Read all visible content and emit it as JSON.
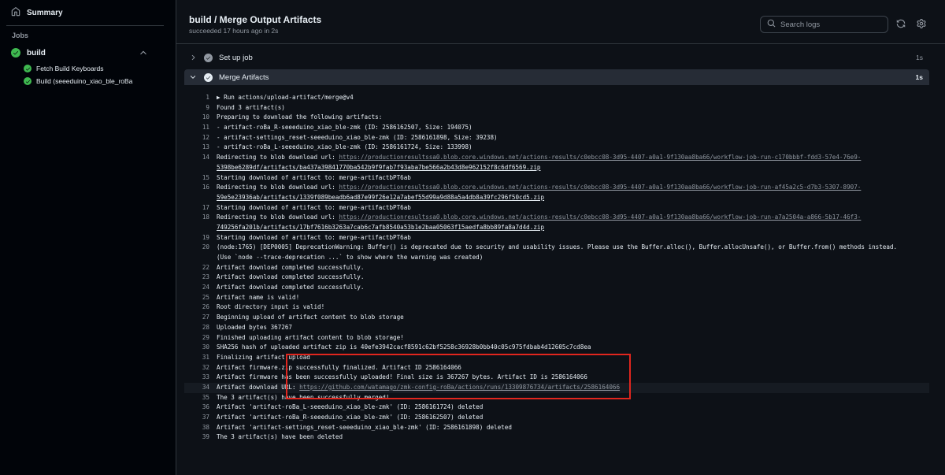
{
  "sidebar": {
    "summary_label": "Summary",
    "jobs_heading": "Jobs",
    "job": {
      "label": "build"
    },
    "steps": [
      {
        "label": "Fetch Build Keyboards"
      },
      {
        "label": "Build (seeeduino_xiao_ble_roBa"
      }
    ]
  },
  "header": {
    "title": "build / Merge Output Artifacts",
    "subtitle": "succeeded 17 hours ago in 2s",
    "search_placeholder": "Search logs"
  },
  "steps": [
    {
      "label": "Set up job",
      "duration": "1s"
    },
    {
      "label": "Merge Artifacts",
      "duration": "1s"
    }
  ],
  "log": [
    {
      "n": "1",
      "t": "▶ Run actions/upload-artifact/merge@v4"
    },
    {
      "n": "9",
      "t": "Found 3 artifact(s)"
    },
    {
      "n": "10",
      "t": "Preparing to download the following artifacts:"
    },
    {
      "n": "11",
      "t": "- artifact-roBa_R-seeeduino_xiao_ble-zmk (ID: 2586162507, Size: 194075)"
    },
    {
      "n": "12",
      "t": "- artifact-settings_reset-seeeduino_xiao_ble-zmk (ID: 2586161898, Size: 39238)"
    },
    {
      "n": "13",
      "t": "- artifact-roBa_L-seeeduino_xiao_ble-zmk (ID: 2586161724, Size: 133998)"
    },
    {
      "n": "14",
      "t": "Redirecting to blob download url: ",
      "link": "https://productionresultssa0.blob.core.windows.net/actions-results/c0ebcc08-3d95-4407-a0a1-9f130aa8ba66/workflow-job-run-c170bbbf-fdd3-57e4-76e9-",
      "cont": "5398be6289df/artifacts/ba437a39841770ba542b9f9fab7f93aba7be566a2b43d8e962152f8c6df6569.zip"
    },
    {
      "n": "15",
      "t": "Starting download of artifact to: merge-artifactbPT6ab"
    },
    {
      "n": "16",
      "t": "Redirecting to blob download url: ",
      "link": "https://productionresultssa0.blob.core.windows.net/actions-results/c0ebcc08-3d95-4407-a0a1-9f130aa8ba66/workflow-job-run-af45a2c5-d7b3-5307-8907-",
      "cont": "59e5e23936ab/artifacts/1339f089beadb6ad87e99f26e12a7abef55d99a9d88a5a4db8a39fc296f50cd5.zip"
    },
    {
      "n": "17",
      "t": "Starting download of artifact to: merge-artifactbPT6ab"
    },
    {
      "n": "18",
      "t": "Redirecting to blob download url: ",
      "link": "https://productionresultssa0.blob.core.windows.net/actions-results/c0ebcc08-3d95-4407-a0a1-9f130aa8ba66/workflow-job-run-a7a2504a-a866-5b17-46f3-",
      "cont": "749256fa201b/artifacts/17bf7616b3263a7cab6c7afb8540a53b1e2baa05063f15aedfa8bb89fa8a7d4d.zip"
    },
    {
      "n": "19",
      "t": "Starting download of artifact to: merge-artifactbPT6ab"
    },
    {
      "n": "20",
      "t": "(node:1765) [DEP0005] DeprecationWarning: Buffer() is deprecated due to security and usability issues. Please use the Buffer.alloc(), Buffer.allocUnsafe(), or Buffer.from() methods instead.",
      "cont_plain": "(Use `node --trace-deprecation ...` to show where the warning was created)"
    },
    {
      "n": "22",
      "t": "Artifact download completed successfully."
    },
    {
      "n": "23",
      "t": "Artifact download completed successfully."
    },
    {
      "n": "24",
      "t": "Artifact download completed successfully."
    },
    {
      "n": "25",
      "t": "Artifact name is valid!"
    },
    {
      "n": "26",
      "t": "Root directory input is valid!"
    },
    {
      "n": "27",
      "t": "Beginning upload of artifact content to blob storage"
    },
    {
      "n": "28",
      "t": "Uploaded bytes 367267"
    },
    {
      "n": "29",
      "t": "Finished uploading artifact content to blob storage!"
    },
    {
      "n": "30",
      "t": "SHA256 hash of uploaded artifact zip is 40efe3942cacf8591c62bf5258c36928b0bb40c05c975fdbab4d12605c7cd8ea"
    },
    {
      "n": "31",
      "t": "Finalizing artifact upload"
    },
    {
      "n": "32",
      "t": "Artifact firmware.zip successfully finalized. Artifact ID 2586164066"
    },
    {
      "n": "33",
      "t": "Artifact firmware has been successfully uploaded! Final size is 367267 bytes. Artifact ID is 2586164066"
    },
    {
      "n": "34",
      "t": "Artifact download URL: ",
      "link": "https://github.com/watamago/zmk-config-roBa/actions/runs/13309876734/artifacts/2586164066",
      "highlight": true
    },
    {
      "n": "35",
      "t": "The 3 artifact(s) have been successfully merged!"
    },
    {
      "n": "36",
      "t": "Artifact 'artifact-roBa_L-seeeduino_xiao_ble-zmk' (ID: 2586161724) deleted"
    },
    {
      "n": "37",
      "t": "Artifact 'artifact-roBa_R-seeeduino_xiao_ble-zmk' (ID: 2586162507) deleted"
    },
    {
      "n": "38",
      "t": "Artifact 'artifact-settings_reset-seeeduino_xiao_ble-zmk' (ID: 2586161898) deleted"
    },
    {
      "n": "39",
      "t": "The 3 artifact(s) have been deleted"
    }
  ],
  "colors": {
    "success": "#3fb950",
    "annotation": "#e0261e",
    "link": "#9198a1"
  }
}
